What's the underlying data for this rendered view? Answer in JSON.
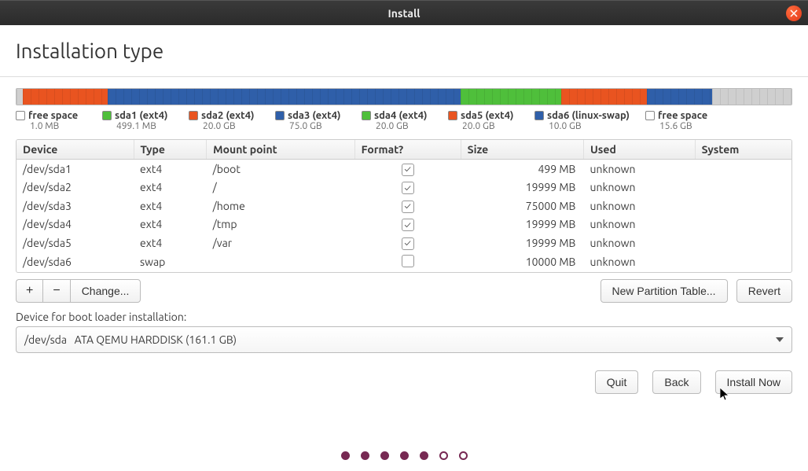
{
  "window": {
    "title": "Install"
  },
  "page": {
    "heading": "Installation type"
  },
  "partbar": [
    {
      "color": "#cfcfcf",
      "width": 0.8
    },
    {
      "color": "#e95420",
      "width": 11.0
    },
    {
      "color": "#2f5fa9",
      "width": 45.5
    },
    {
      "color": "#4fbf3b",
      "width": 13.0
    },
    {
      "color": "#e95420",
      "width": 11.0
    },
    {
      "color": "#2f5fa9",
      "width": 8.5
    },
    {
      "color": "#cfcfcf",
      "width": 10.2
    }
  ],
  "legend": [
    {
      "swatch": "#ffffff",
      "label": "free space",
      "sub": "1.0 MB"
    },
    {
      "swatch": "#4fbf3b",
      "label": "sda1 (ext4)",
      "sub": "499.1 MB"
    },
    {
      "swatch": "#e95420",
      "label": "sda2 (ext4)",
      "sub": "20.0 GB"
    },
    {
      "swatch": "#2f5fa9",
      "label": "sda3 (ext4)",
      "sub": "75.0 GB"
    },
    {
      "swatch": "#4fbf3b",
      "label": "sda4 (ext4)",
      "sub": "20.0 GB"
    },
    {
      "swatch": "#e95420",
      "label": "sda5 (ext4)",
      "sub": "20.0 GB"
    },
    {
      "swatch": "#2f5fa9",
      "label": "sda6 (linux-swap)",
      "sub": "10.0 GB"
    },
    {
      "swatch": "#ffffff",
      "label": "free space",
      "sub": "15.6 GB"
    }
  ],
  "table": {
    "headers": [
      "Device",
      "Type",
      "Mount point",
      "Format?",
      "Size",
      "Used",
      "System"
    ],
    "rows": [
      {
        "device": "/dev/sda1",
        "type": "ext4",
        "mount": "/boot",
        "format": true,
        "size": "499 MB",
        "used": "unknown",
        "system": ""
      },
      {
        "device": "/dev/sda2",
        "type": "ext4",
        "mount": "/",
        "format": true,
        "size": "19999 MB",
        "used": "unknown",
        "system": ""
      },
      {
        "device": "/dev/sda3",
        "type": "ext4",
        "mount": "/home",
        "format": true,
        "size": "75000 MB",
        "used": "unknown",
        "system": ""
      },
      {
        "device": "/dev/sda4",
        "type": "ext4",
        "mount": "/tmp",
        "format": true,
        "size": "19999 MB",
        "used": "unknown",
        "system": ""
      },
      {
        "device": "/dev/sda5",
        "type": "ext4",
        "mount": "/var",
        "format": true,
        "size": "19999 MB",
        "used": "unknown",
        "system": ""
      },
      {
        "device": "/dev/sda6",
        "type": "swap",
        "mount": "",
        "format": false,
        "size": "10000 MB",
        "used": "unknown",
        "system": ""
      }
    ]
  },
  "buttons": {
    "add": "+",
    "remove": "−",
    "change": "Change...",
    "new_partition_table": "New Partition Table...",
    "revert": "Revert",
    "quit": "Quit",
    "back": "Back",
    "install_now": "Install Now"
  },
  "bootloader": {
    "label": "Device for boot loader installation:",
    "value": "/dev/sda   ATA QEMU HARDDISK (161.1 GB)"
  },
  "steps": {
    "total": 7,
    "current": 5
  }
}
